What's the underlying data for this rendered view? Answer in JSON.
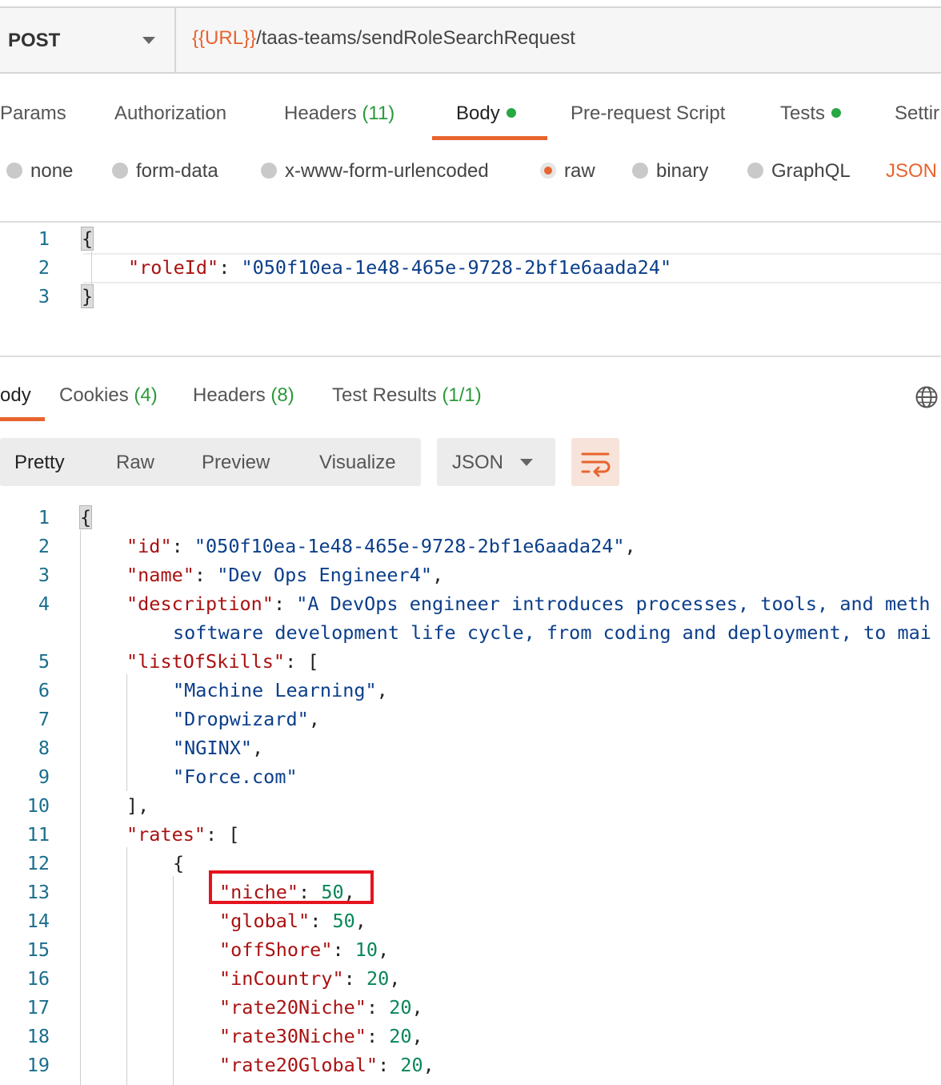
{
  "request": {
    "method": "POST",
    "url_var": "{{URL}}",
    "url_path": "/taas-teams/sendRoleSearchRequest"
  },
  "request_tabs": {
    "params": "Params",
    "authorization": "Authorization",
    "headers": "Headers",
    "headers_count": "(11)",
    "body": "Body",
    "prerequest": "Pre-request Script",
    "tests": "Tests",
    "settings": "Settir"
  },
  "body_types": {
    "none": "none",
    "form_data": "form-data",
    "urlencoded": "x-www-form-urlencoded",
    "raw": "raw",
    "binary": "binary",
    "graphql": "GraphQL",
    "json": "JSON",
    "selected": "raw"
  },
  "request_body": {
    "open": "{",
    "key": "\"roleId\"",
    "colon": ": ",
    "value": "\"050f10ea-1e48-465e-9728-2bf1e6aada24\"",
    "close": "}",
    "line_numbers": [
      "1",
      "2",
      "3"
    ]
  },
  "response_tabs": {
    "body": "ody",
    "cookies": "Cookies",
    "cookies_count": "(4)",
    "headers": "Headers",
    "headers_count": "(8)",
    "test_results": "Test Results",
    "test_results_count": "(1/1)"
  },
  "response_view": {
    "pretty": "Pretty",
    "raw": "Raw",
    "preview": "Preview",
    "visualize": "Visualize",
    "format": "JSON"
  },
  "response_body": {
    "line_numbers": [
      "1",
      "2",
      "3",
      "4",
      "5",
      "6",
      "7",
      "8",
      "9",
      "10",
      "11",
      "12",
      "13",
      "14",
      "15",
      "16",
      "17",
      "18",
      "19"
    ],
    "open": "{",
    "id_key": "\"id\"",
    "id_val": "\"050f10ea-1e48-465e-9728-2bf1e6aada24\"",
    "name_key": "\"name\"",
    "name_val": "\"Dev Ops Engineer4\"",
    "desc_key": "\"description\"",
    "desc_val_1": "\"A DevOps engineer introduces processes, tools, and meth",
    "desc_val_2": "software development life cycle, from coding and deployment, to mai",
    "skills_key": "\"listOfSkills\"",
    "skills": [
      "\"Machine Learning\"",
      "\"Dropwizard\"",
      "\"NGINX\"",
      "\"Force.com\""
    ],
    "skills_close": "],",
    "rates_key": "\"rates\"",
    "obj_open": "{",
    "rates": [
      {
        "key": "\"niche\"",
        "value": "50"
      },
      {
        "key": "\"global\"",
        "value": "50"
      },
      {
        "key": "\"offShore\"",
        "value": "10"
      },
      {
        "key": "\"inCountry\"",
        "value": "20"
      },
      {
        "key": "\"rate20Niche\"",
        "value": "20"
      },
      {
        "key": "\"rate30Niche\"",
        "value": "20"
      },
      {
        "key": "\"rate20Global\"",
        "value": "20"
      }
    ]
  },
  "colors": {
    "accent": "#e8642f",
    "green": "#27a844",
    "highlight_box": "#e5131d"
  }
}
